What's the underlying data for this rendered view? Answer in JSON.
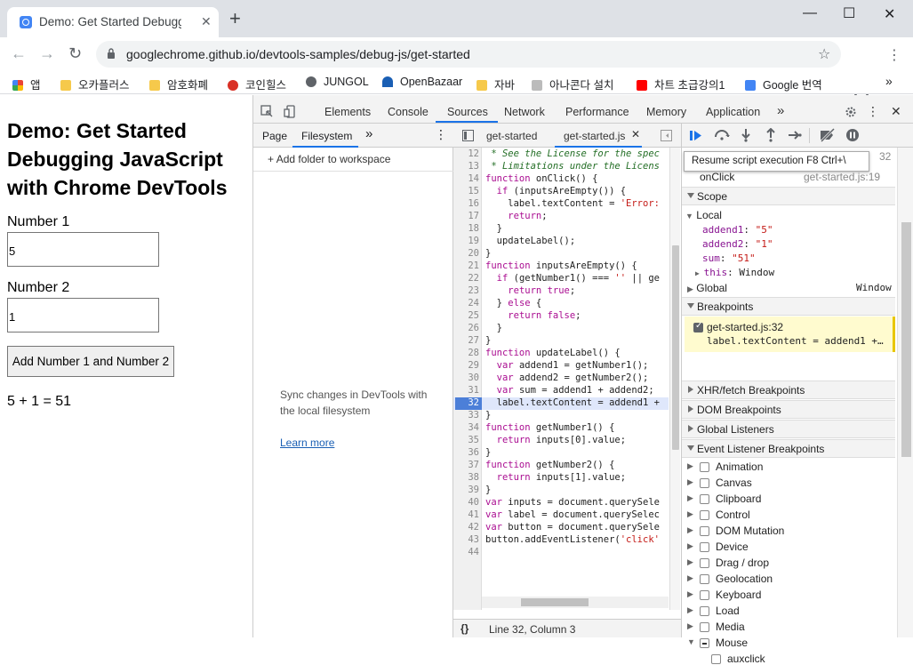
{
  "browser": {
    "tab_title": "Demo: Get Started Debugging J",
    "url": "googlechrome.github.io/devtools-samples/debug-js/get-started",
    "bookmarks": [
      "앱",
      "오카플러스",
      "암호화폐",
      "코인힐스",
      "JUNGOL",
      "OpenBazaar",
      "자바",
      "아나콘다 설치",
      "차트 초급강의1",
      "Google 번역"
    ],
    "bookmark_overflow": "»"
  },
  "page": {
    "heading": "Demo: Get Started Debugging JavaScript with Chrome DevTools",
    "label1": "Number 1",
    "value1": "5",
    "label2": "Number 2",
    "value2": "1",
    "button": "Add Number 1 and Number 2",
    "result": "5 + 1 = 51"
  },
  "devtools": {
    "tabs": [
      "Elements",
      "Console",
      "Sources",
      "Network",
      "Performance",
      "Memory",
      "Application"
    ],
    "active_tab": "Sources",
    "nav_tabs": [
      "Page",
      "Filesystem"
    ],
    "add_folder": "Add folder to workspace",
    "sync_text": "Sync changes in DevTools with the local filesystem",
    "learn_more": "Learn more",
    "editor_tabs": [
      "get-started",
      "get-started.js"
    ],
    "status": "Line 32, Column 3",
    "tooltip": "Resume script execution  F8  Ctrl+\\",
    "call_stack": {
      "fn": "onClick",
      "loc": "get-started.js:19"
    },
    "scope_label": "Scope",
    "local_label": "Local",
    "scope_vars": [
      {
        "name": "addend1",
        "value": "\"5\""
      },
      {
        "name": "addend2",
        "value": "\"1\""
      },
      {
        "name": "sum",
        "value": "\"51\""
      },
      {
        "name": "this",
        "value": "Window"
      }
    ],
    "global_label": "Global",
    "global_value": "Window",
    "breakpoints_label": "Breakpoints",
    "breakpoint": {
      "file": "get-started.js:32",
      "code": "label.textContent = addend1 +…"
    },
    "sections": [
      "XHR/fetch Breakpoints",
      "DOM Breakpoints",
      "Global Listeners",
      "Event Listener Breakpoints"
    ],
    "event_listeners": [
      "Animation",
      "Canvas",
      "Clipboard",
      "Control",
      "DOM Mutation",
      "Device",
      "Drag / drop",
      "Geolocation",
      "Keyboard",
      "Load",
      "Media",
      "Mouse"
    ],
    "mouse_sub": "auxclick",
    "tooltip_peek": "32"
  },
  "code_lines": [
    {
      "n": "12",
      "t": "cm",
      "s": " * See the License for the spec"
    },
    {
      "n": "13",
      "t": "cm",
      "s": " * Limitations under the Licens"
    },
    {
      "n": "14",
      "t": "",
      "s": "function onClick() {"
    },
    {
      "n": "15",
      "t": "",
      "s": "  if (inputsAreEmpty()) {"
    },
    {
      "n": "16",
      "t": "",
      "s": "    label.textContent = 'Error:"
    },
    {
      "n": "17",
      "t": "",
      "s": "    return;"
    },
    {
      "n": "18",
      "t": "",
      "s": "  }"
    },
    {
      "n": "19",
      "t": "",
      "s": "  updateLabel();"
    },
    {
      "n": "20",
      "t": "",
      "s": "}"
    },
    {
      "n": "21",
      "t": "",
      "s": "function inputsAreEmpty() {"
    },
    {
      "n": "22",
      "t": "",
      "s": "  if (getNumber1() === '' || ge"
    },
    {
      "n": "23",
      "t": "",
      "s": "    return true;"
    },
    {
      "n": "24",
      "t": "",
      "s": "  } else {"
    },
    {
      "n": "25",
      "t": "",
      "s": "    return false;"
    },
    {
      "n": "26",
      "t": "",
      "s": "  }"
    },
    {
      "n": "27",
      "t": "",
      "s": "}"
    },
    {
      "n": "28",
      "t": "",
      "s": "function updateLabel() {"
    },
    {
      "n": "29",
      "t": "",
      "s": "  var addend1 = getNumber1();"
    },
    {
      "n": "30",
      "t": "",
      "s": "  var addend2 = getNumber2();"
    },
    {
      "n": "31",
      "t": "",
      "s": "  var sum = addend1 + addend2;"
    },
    {
      "n": "32",
      "t": "",
      "s": "  label.textContent = addend1 +"
    },
    {
      "n": "33",
      "t": "",
      "s": "}"
    },
    {
      "n": "34",
      "t": "",
      "s": "function getNumber1() {"
    },
    {
      "n": "35",
      "t": "",
      "s": "  return inputs[0].value;"
    },
    {
      "n": "36",
      "t": "",
      "s": "}"
    },
    {
      "n": "37",
      "t": "",
      "s": "function getNumber2() {"
    },
    {
      "n": "38",
      "t": "",
      "s": "  return inputs[1].value;"
    },
    {
      "n": "39",
      "t": "",
      "s": "}"
    },
    {
      "n": "40",
      "t": "",
      "s": "var inputs = document.querySele"
    },
    {
      "n": "41",
      "t": "",
      "s": "var label = document.querySelec"
    },
    {
      "n": "42",
      "t": "",
      "s": "var button = document.querySele"
    },
    {
      "n": "43",
      "t": "",
      "s": "button.addEventListener('click'"
    },
    {
      "n": "44",
      "t": "",
      "s": ""
    }
  ],
  "colors": {
    "accent": "#1a73e8",
    "breakpoint": "#4c7fd8"
  }
}
